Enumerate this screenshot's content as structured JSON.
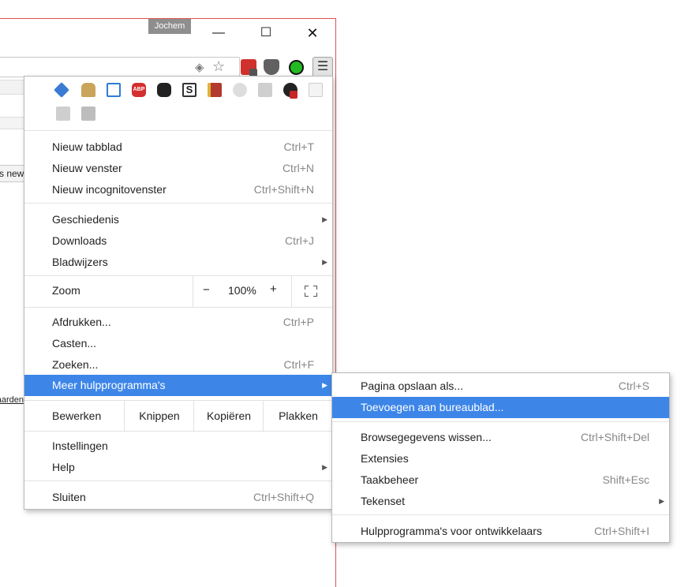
{
  "window": {
    "user_name": "Jochem",
    "partial_page_button": "s new",
    "partial_page_link": "aarden"
  },
  "extensions": [
    "graduation-cap-icon",
    "lock-icon",
    "window-icon",
    "adblock-plus-icon",
    "ghostery-icon",
    "s-icon",
    "book-icon",
    "gear-icon",
    "bowtie-icon",
    "github-icon",
    "pigeon-icon",
    "google-plus-icon",
    "google-plus-icon-2"
  ],
  "menu": {
    "new_tab": {
      "label": "Nieuw tabblad",
      "shortcut": "Ctrl+T"
    },
    "new_window": {
      "label": "Nieuw venster",
      "shortcut": "Ctrl+N"
    },
    "new_incognito": {
      "label": "Nieuw incognitovenster",
      "shortcut": "Ctrl+Shift+N"
    },
    "history": {
      "label": "Geschiedenis"
    },
    "downloads": {
      "label": "Downloads",
      "shortcut": "Ctrl+J"
    },
    "bookmarks": {
      "label": "Bladwijzers"
    },
    "zoom": {
      "label": "Zoom",
      "minus": "−",
      "value": "100%",
      "plus": "+"
    },
    "print": {
      "label": "Afdrukken...",
      "shortcut": "Ctrl+P"
    },
    "cast": {
      "label": "Casten..."
    },
    "find": {
      "label": "Zoeken...",
      "shortcut": "Ctrl+F"
    },
    "more_tools": {
      "label": "Meer hulpprogramma's"
    },
    "edit": {
      "label": "Bewerken",
      "cut": "Knippen",
      "copy": "Kopiëren",
      "paste": "Plakken"
    },
    "settings": {
      "label": "Instellingen"
    },
    "help": {
      "label": "Help"
    },
    "exit": {
      "label": "Sluiten",
      "shortcut": "Ctrl+Shift+Q"
    }
  },
  "submenu": {
    "save_page": {
      "label": "Pagina opslaan als...",
      "shortcut": "Ctrl+S"
    },
    "add_to_desktop": {
      "label": "Toevoegen aan bureaublad..."
    },
    "clear_data": {
      "label": "Browsegegevens wissen...",
      "shortcut": "Ctrl+Shift+Del"
    },
    "extensions": {
      "label": "Extensies"
    },
    "task_manager": {
      "label": "Taakbeheer",
      "shortcut": "Shift+Esc"
    },
    "encoding": {
      "label": "Tekenset"
    },
    "dev_tools": {
      "label": "Hulpprogramma's voor ontwikkelaars",
      "shortcut": "Ctrl+Shift+I"
    }
  },
  "colors": {
    "highlight": "#3d86e8",
    "window_border": "#d9534f"
  }
}
